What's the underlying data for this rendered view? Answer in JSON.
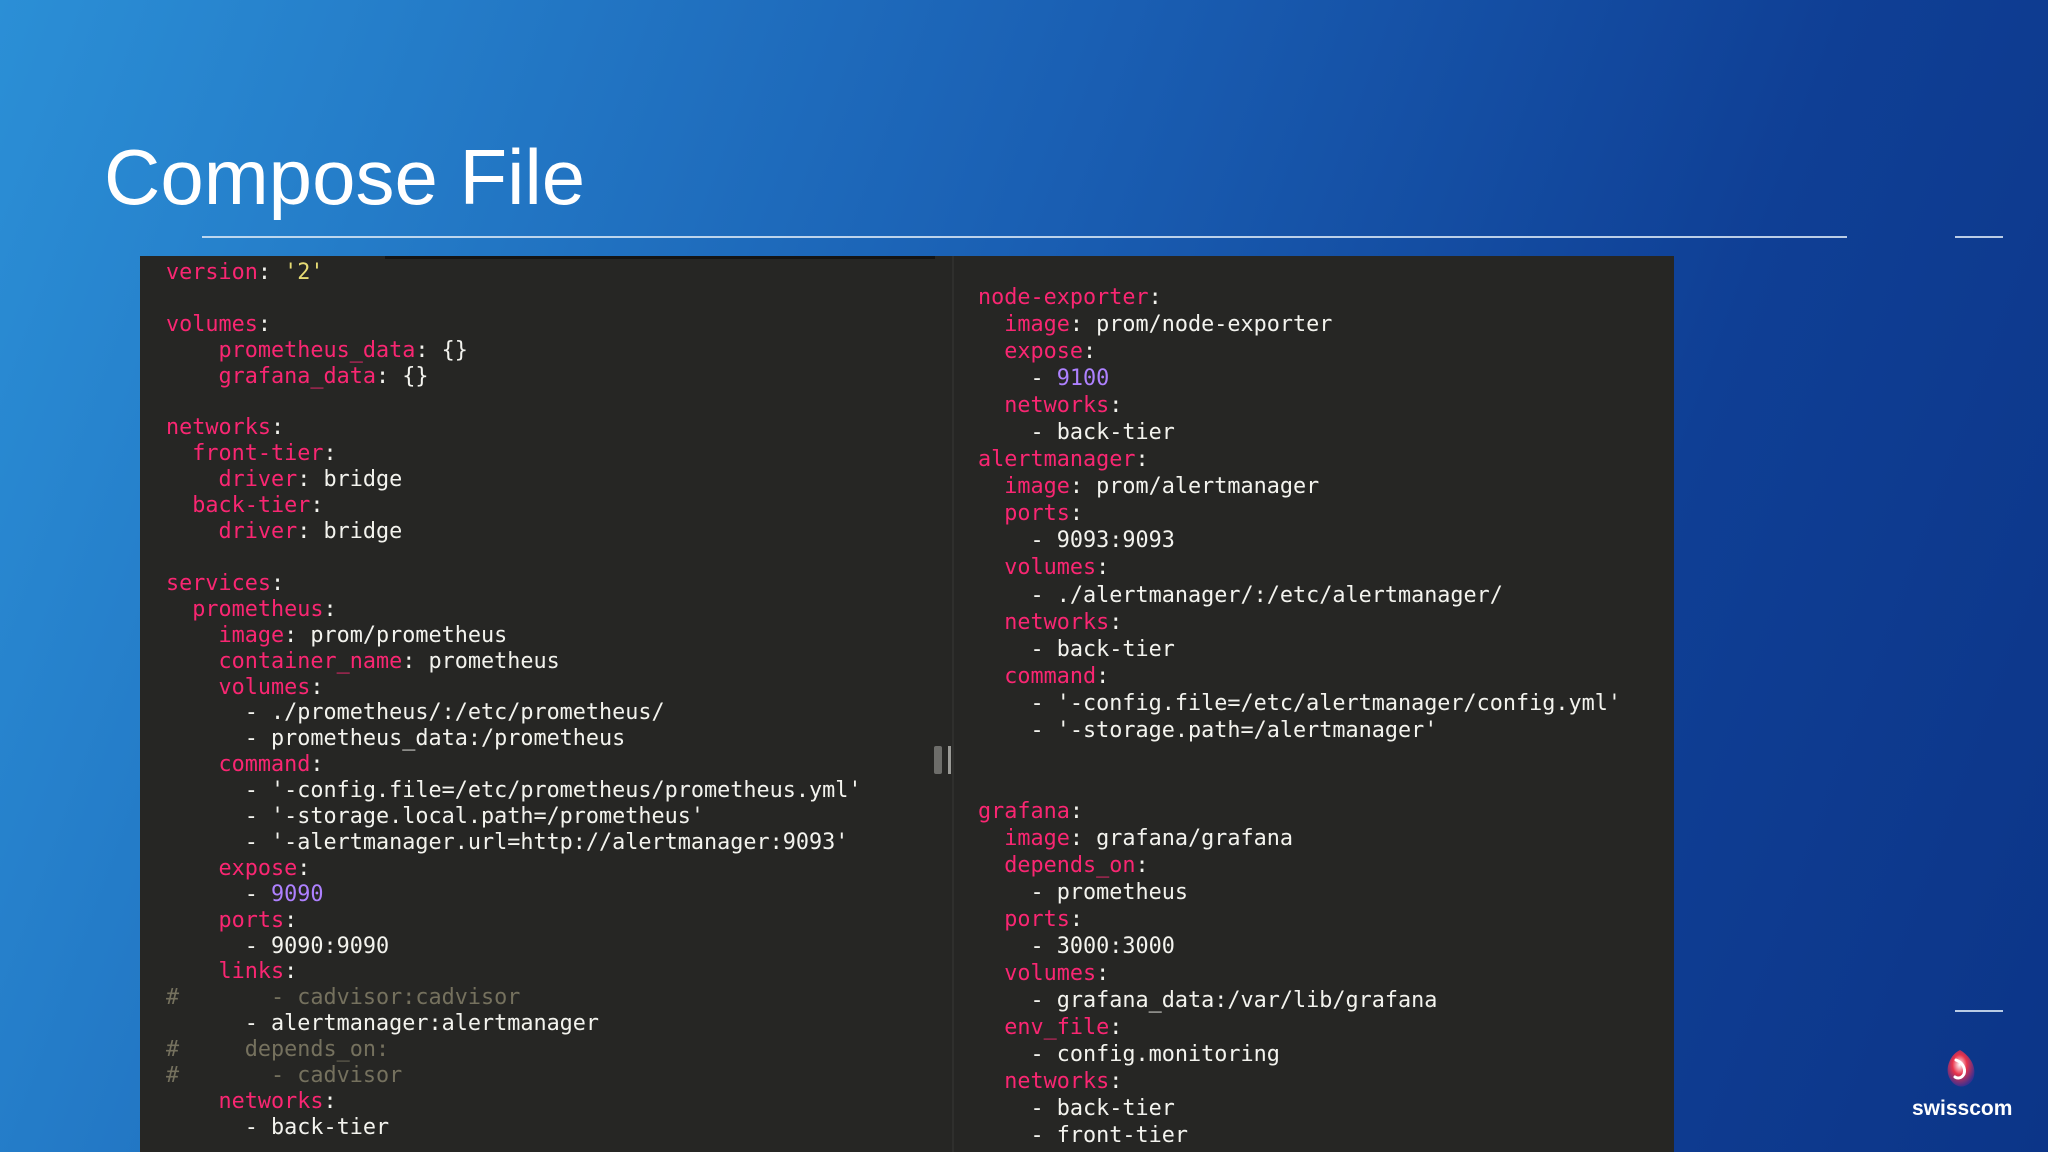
{
  "slide": {
    "title": "Compose File",
    "brand": "swisscom"
  },
  "colors": {
    "background_start": "#2b8fd6",
    "background_end": "#0c3588",
    "editor_bg": "#262624",
    "key": "#f92672",
    "string": "#e6db74",
    "number": "#ae81ff",
    "comment": "#75715e",
    "plain": "#f3f3ee"
  },
  "editor": {
    "left_pane": {
      "lines": [
        {
          "parts": [
            [
              "version",
              "key"
            ],
            [
              ": ",
              "punct"
            ],
            [
              "'2'",
              "str"
            ]
          ]
        },
        {
          "parts": []
        },
        {
          "parts": [
            [
              "volumes",
              "key"
            ],
            [
              ":",
              "punct"
            ]
          ]
        },
        {
          "parts": [
            [
              "    ",
              ""
            ],
            [
              "prometheus_data",
              "key"
            ],
            [
              ": ",
              "punct"
            ],
            [
              "{}",
              "val"
            ]
          ]
        },
        {
          "parts": [
            [
              "    ",
              ""
            ],
            [
              "grafana_data",
              "key"
            ],
            [
              ": ",
              "punct"
            ],
            [
              "{}",
              "val"
            ]
          ]
        },
        {
          "parts": []
        },
        {
          "parts": [
            [
              "networks",
              "key"
            ],
            [
              ":",
              "punct"
            ]
          ]
        },
        {
          "parts": [
            [
              "  ",
              ""
            ],
            [
              "front-tier",
              "key"
            ],
            [
              ":",
              "punct"
            ]
          ]
        },
        {
          "parts": [
            [
              "    ",
              ""
            ],
            [
              "driver",
              "key"
            ],
            [
              ": ",
              "punct"
            ],
            [
              "bridge",
              "val"
            ]
          ]
        },
        {
          "parts": [
            [
              "  ",
              ""
            ],
            [
              "back-tier",
              "key"
            ],
            [
              ":",
              "punct"
            ]
          ]
        },
        {
          "parts": [
            [
              "    ",
              ""
            ],
            [
              "driver",
              "key"
            ],
            [
              ": ",
              "punct"
            ],
            [
              "bridge",
              "val"
            ]
          ]
        },
        {
          "parts": []
        },
        {
          "parts": [
            [
              "services",
              "key"
            ],
            [
              ":",
              "punct"
            ]
          ]
        },
        {
          "parts": [
            [
              "  ",
              ""
            ],
            [
              "prometheus",
              "key"
            ],
            [
              ":",
              "punct"
            ]
          ]
        },
        {
          "parts": [
            [
              "    ",
              ""
            ],
            [
              "image",
              "key"
            ],
            [
              ": ",
              "punct"
            ],
            [
              "prom/prometheus",
              "val"
            ]
          ]
        },
        {
          "parts": [
            [
              "    ",
              ""
            ],
            [
              "container_name",
              "key"
            ],
            [
              ": ",
              "punct"
            ],
            [
              "prometheus",
              "val"
            ]
          ]
        },
        {
          "parts": [
            [
              "    ",
              ""
            ],
            [
              "volumes",
              "key"
            ],
            [
              ":",
              "punct"
            ]
          ]
        },
        {
          "parts": [
            [
              "      - ",
              "val"
            ],
            [
              "./prometheus/:/etc/prometheus/",
              "val"
            ]
          ]
        },
        {
          "parts": [
            [
              "      - ",
              "val"
            ],
            [
              "prometheus_data:/prometheus",
              "val"
            ]
          ]
        },
        {
          "parts": [
            [
              "    ",
              ""
            ],
            [
              "command",
              "key"
            ],
            [
              ":",
              "punct"
            ]
          ]
        },
        {
          "parts": [
            [
              "      - ",
              "val"
            ],
            [
              "'-config.file=/etc/prometheus/prometheus.yml'",
              "val"
            ]
          ]
        },
        {
          "parts": [
            [
              "      - ",
              "val"
            ],
            [
              "'-storage.local.path=/prometheus'",
              "val"
            ]
          ]
        },
        {
          "parts": [
            [
              "      - ",
              "val"
            ],
            [
              "'-alertmanager.url=http://alertmanager:9093'",
              "val"
            ]
          ]
        },
        {
          "parts": [
            [
              "    ",
              ""
            ],
            [
              "expose",
              "key"
            ],
            [
              ":",
              "punct"
            ]
          ]
        },
        {
          "parts": [
            [
              "      - ",
              "val"
            ],
            [
              "9090",
              "num"
            ]
          ]
        },
        {
          "parts": [
            [
              "    ",
              ""
            ],
            [
              "ports",
              "key"
            ],
            [
              ":",
              "punct"
            ]
          ]
        },
        {
          "parts": [
            [
              "      - ",
              "val"
            ],
            [
              "9090:9090",
              "val"
            ]
          ]
        },
        {
          "parts": [
            [
              "    ",
              ""
            ],
            [
              "links",
              "key"
            ],
            [
              ":",
              "punct"
            ]
          ]
        },
        {
          "parts": [
            [
              "#       - cadvisor:cadvisor",
              "cmt"
            ]
          ]
        },
        {
          "parts": [
            [
              "      - ",
              "val"
            ],
            [
              "alertmanager:alertmanager",
              "val"
            ]
          ]
        },
        {
          "parts": [
            [
              "#     depends_on:",
              "cmt"
            ]
          ]
        },
        {
          "parts": [
            [
              "#       - cadvisor",
              "cmt"
            ]
          ]
        },
        {
          "parts": [
            [
              "    ",
              ""
            ],
            [
              "networks",
              "key"
            ],
            [
              ":",
              "punct"
            ]
          ]
        },
        {
          "parts": [
            [
              "      - ",
              "val"
            ],
            [
              "back-tier",
              "val"
            ]
          ]
        }
      ]
    },
    "right_pane": {
      "lines": [
        {
          "parts": [
            [
              "node-exporter",
              "key"
            ],
            [
              ":",
              "punct"
            ]
          ]
        },
        {
          "parts": [
            [
              "  ",
              ""
            ],
            [
              "image",
              "key"
            ],
            [
              ": ",
              "punct"
            ],
            [
              "prom/node-exporter",
              "val"
            ]
          ]
        },
        {
          "parts": [
            [
              "  ",
              ""
            ],
            [
              "expose",
              "key"
            ],
            [
              ":",
              "punct"
            ]
          ]
        },
        {
          "parts": [
            [
              "    - ",
              "val"
            ],
            [
              "9100",
              "num"
            ]
          ]
        },
        {
          "parts": [
            [
              "  ",
              ""
            ],
            [
              "networks",
              "key"
            ],
            [
              ":",
              "punct"
            ]
          ]
        },
        {
          "parts": [
            [
              "    - ",
              "val"
            ],
            [
              "back-tier",
              "val"
            ]
          ]
        },
        {
          "parts": [
            [
              "alertmanager",
              "key"
            ],
            [
              ":",
              "punct"
            ]
          ]
        },
        {
          "parts": [
            [
              "  ",
              ""
            ],
            [
              "image",
              "key"
            ],
            [
              ": ",
              "punct"
            ],
            [
              "prom/alertmanager",
              "val"
            ]
          ]
        },
        {
          "parts": [
            [
              "  ",
              ""
            ],
            [
              "ports",
              "key"
            ],
            [
              ":",
              "punct"
            ]
          ]
        },
        {
          "parts": [
            [
              "    - ",
              "val"
            ],
            [
              "9093:9093",
              "val"
            ]
          ]
        },
        {
          "parts": [
            [
              "  ",
              ""
            ],
            [
              "volumes",
              "key"
            ],
            [
              ":",
              "punct"
            ]
          ]
        },
        {
          "parts": [
            [
              "    - ",
              "val"
            ],
            [
              "./alertmanager/:/etc/alertmanager/",
              "val"
            ]
          ]
        },
        {
          "parts": [
            [
              "  ",
              ""
            ],
            [
              "networks",
              "key"
            ],
            [
              ":",
              "punct"
            ]
          ]
        },
        {
          "parts": [
            [
              "    - ",
              "val"
            ],
            [
              "back-tier",
              "val"
            ]
          ]
        },
        {
          "parts": [
            [
              "  ",
              ""
            ],
            [
              "command",
              "key"
            ],
            [
              ":",
              "punct"
            ]
          ]
        },
        {
          "parts": [
            [
              "    - ",
              "val"
            ],
            [
              "'-config.file=/etc/alertmanager/config.yml'",
              "val"
            ]
          ]
        },
        {
          "parts": [
            [
              "    - ",
              "val"
            ],
            [
              "'-storage.path=/alertmanager'",
              "val"
            ]
          ]
        },
        {
          "parts": []
        },
        {
          "parts": []
        },
        {
          "parts": [
            [
              "grafana",
              "key"
            ],
            [
              ":",
              "punct"
            ]
          ]
        },
        {
          "parts": [
            [
              "  ",
              ""
            ],
            [
              "image",
              "key"
            ],
            [
              ": ",
              "punct"
            ],
            [
              "grafana/grafana",
              "val"
            ]
          ]
        },
        {
          "parts": [
            [
              "  ",
              ""
            ],
            [
              "depends_on",
              "key"
            ],
            [
              ":",
              "punct"
            ]
          ]
        },
        {
          "parts": [
            [
              "    - ",
              "val"
            ],
            [
              "prometheus",
              "val"
            ]
          ]
        },
        {
          "parts": [
            [
              "  ",
              ""
            ],
            [
              "ports",
              "key"
            ],
            [
              ":",
              "punct"
            ]
          ]
        },
        {
          "parts": [
            [
              "    - ",
              "val"
            ],
            [
              "3000:3000",
              "val"
            ]
          ]
        },
        {
          "parts": [
            [
              "  ",
              ""
            ],
            [
              "volumes",
              "key"
            ],
            [
              ":",
              "punct"
            ]
          ]
        },
        {
          "parts": [
            [
              "    - ",
              "val"
            ],
            [
              "grafana_data:/var/lib/grafana",
              "val"
            ]
          ]
        },
        {
          "parts": [
            [
              "  ",
              ""
            ],
            [
              "env_file",
              "key"
            ],
            [
              ":",
              "punct"
            ]
          ]
        },
        {
          "parts": [
            [
              "    - ",
              "val"
            ],
            [
              "config.monitoring",
              "val"
            ]
          ]
        },
        {
          "parts": [
            [
              "  ",
              ""
            ],
            [
              "networks",
              "key"
            ],
            [
              ":",
              "punct"
            ]
          ]
        },
        {
          "parts": [
            [
              "    - ",
              "val"
            ],
            [
              "back-tier",
              "val"
            ]
          ]
        },
        {
          "parts": [
            [
              "    - ",
              "val"
            ],
            [
              "front-tier",
              "val"
            ]
          ]
        }
      ]
    }
  }
}
